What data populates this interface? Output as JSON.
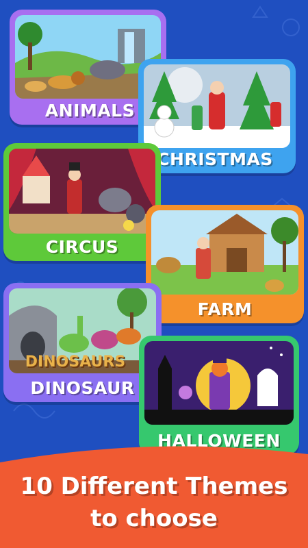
{
  "themes": [
    {
      "label": "ANIMALS",
      "color": "#a86ff0"
    },
    {
      "label": "CHRISTMAS",
      "color": "#3ea3ef"
    },
    {
      "label": "CIRCUS",
      "color": "#5ec93a"
    },
    {
      "label": "FARM",
      "color": "#f5912b"
    },
    {
      "label": "DINOSAUR",
      "color": "#8a6ff2"
    },
    {
      "label": "HALLOWEEN",
      "color": "#36c86e"
    }
  ],
  "dino_logo": "DINOSAURS",
  "banner": {
    "line1": "10 Different Themes",
    "line2": "to choose",
    "color": "#f05a32"
  },
  "background_color": "#1f4fc0"
}
